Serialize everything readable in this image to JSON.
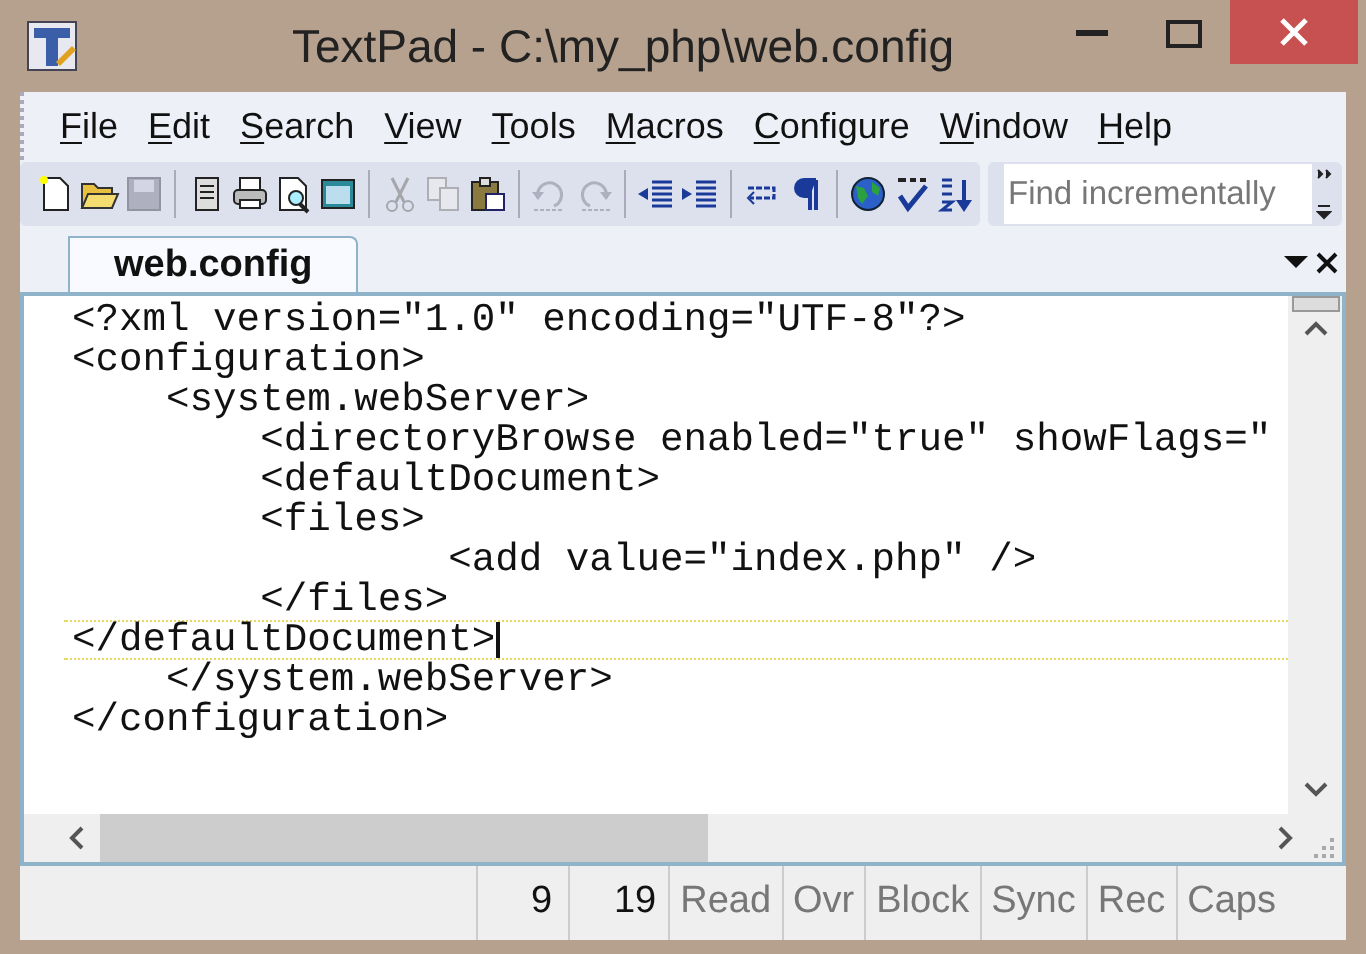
{
  "window": {
    "title": "TextPad - C:\\my_php\\web.config"
  },
  "menu": [
    "File",
    "Edit",
    "Search",
    "View",
    "Tools",
    "Macros",
    "Configure",
    "Window",
    "Help"
  ],
  "toolbar": [
    {
      "kind": "new",
      "disabled": false
    },
    {
      "kind": "open",
      "disabled": false
    },
    {
      "kind": "save",
      "disabled": true
    },
    {
      "kind": "sep"
    },
    {
      "kind": "files",
      "disabled": false
    },
    {
      "kind": "print",
      "disabled": false
    },
    {
      "kind": "preview",
      "disabled": false
    },
    {
      "kind": "window",
      "disabled": false
    },
    {
      "kind": "sep"
    },
    {
      "kind": "cut",
      "disabled": true
    },
    {
      "kind": "copy",
      "disabled": true
    },
    {
      "kind": "paste",
      "disabled": false
    },
    {
      "kind": "sep"
    },
    {
      "kind": "undo",
      "disabled": true
    },
    {
      "kind": "redo",
      "disabled": true
    },
    {
      "kind": "sep"
    },
    {
      "kind": "outdent",
      "disabled": false
    },
    {
      "kind": "indent",
      "disabled": false
    },
    {
      "kind": "sep"
    },
    {
      "kind": "wrap",
      "disabled": false
    },
    {
      "kind": "pilcrow",
      "disabled": false
    },
    {
      "kind": "sep"
    },
    {
      "kind": "globe",
      "disabled": false
    },
    {
      "kind": "spell",
      "disabled": false
    },
    {
      "kind": "sort",
      "disabled": false
    }
  ],
  "search": {
    "placeholder": "Find incrementally"
  },
  "tabs": [
    {
      "label": "web.config",
      "selected": true
    }
  ],
  "editor": {
    "lines": [
      {
        "text": "<?xml version=\"1.0\" encoding=\"UTF-8\"?>",
        "current": false
      },
      {
        "text": "<configuration>",
        "current": false
      },
      {
        "text": "    <system.webServer>",
        "current": false
      },
      {
        "text": "        <directoryBrowse enabled=\"true\" showFlags=\"",
        "current": false
      },
      {
        "text": "        <defaultDocument>",
        "current": false
      },
      {
        "text": "        <files>",
        "current": false
      },
      {
        "text": "                <add value=\"index.php\" />",
        "current": false
      },
      {
        "text": "        </files>",
        "current": false
      },
      {
        "text": "</defaultDocument>",
        "current": true
      },
      {
        "text": "    </system.webServer>",
        "current": false
      },
      {
        "text": "</configuration>",
        "current": false
      }
    ]
  },
  "status_bar": {
    "line": "9",
    "column": "19",
    "indicators": [
      {
        "label": "Read",
        "disabled": true
      },
      {
        "label": "Ovr",
        "disabled": true
      },
      {
        "label": "Block",
        "disabled": true
      },
      {
        "label": "Sync",
        "disabled": true
      },
      {
        "label": "Rec",
        "disabled": true
      },
      {
        "label": "Caps",
        "disabled": true
      }
    ]
  }
}
